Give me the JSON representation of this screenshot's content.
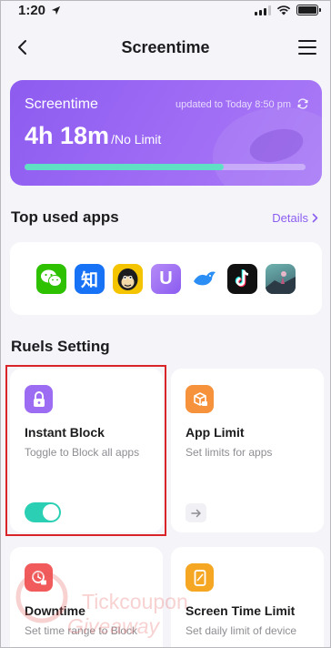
{
  "status_bar": {
    "time": "1:20"
  },
  "nav": {
    "title": "Screentime"
  },
  "screentime_card": {
    "title": "Screentime",
    "updated": "updated to Today 8:50 pm",
    "usage_time": "4h 18m",
    "limit": "/No Limit",
    "progress_fraction": 0.71,
    "bar_color": "#5fe0c5"
  },
  "top_apps": {
    "title": "Top used apps",
    "details_label": "Details",
    "apps": [
      {
        "icon": "wechat-icon",
        "color": "#2dc100"
      },
      {
        "icon": "zhihu-icon",
        "color": "#1772f6",
        "text": "知"
      },
      {
        "icon": "monkey-app-icon",
        "color": "#f5c400"
      },
      {
        "icon": "u-app-icon",
        "color": "#9b6cf3",
        "text": "U"
      },
      {
        "icon": "bird-app-icon",
        "color": "#2b8ef5"
      },
      {
        "icon": "tiktok-icon",
        "color": "#111111"
      },
      {
        "icon": "game-app-icon",
        "color": "#4f8a8b"
      }
    ]
  },
  "rules": {
    "title": "Ruels Setting",
    "cards": [
      {
        "title": "Instant Block",
        "desc": "Toggle to Block all apps",
        "icon": "lock-icon",
        "color": "#9c6cf3",
        "toggle_on": true
      },
      {
        "title": "App Limit",
        "desc": "Set limits for apps",
        "icon": "app-limit-icon",
        "color": "#f5923b"
      },
      {
        "title": "Downtime",
        "desc": "Set time range to Block",
        "icon": "clock-lock-icon",
        "color": "#f25b5b"
      },
      {
        "title": "Screen Time Limit",
        "desc": "Set daily limit of device",
        "icon": "phone-icon",
        "color": "#f5a623"
      }
    ]
  },
  "watermark": {
    "line1": "Tickcoupon",
    "line2": "Giveaway"
  }
}
